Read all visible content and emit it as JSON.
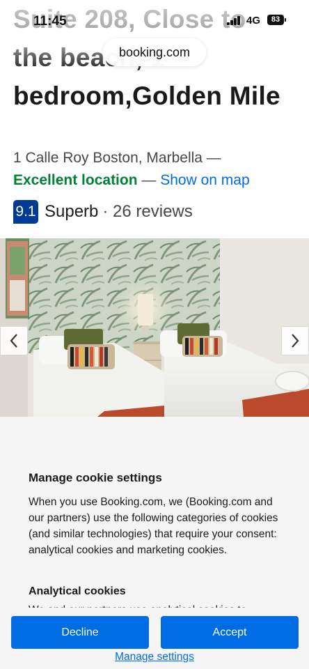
{
  "status_bar": {
    "time": "11:45",
    "network": "4G",
    "battery": "83",
    "url": "booking.com"
  },
  "property": {
    "title": "Suite 208, Close to the beach, 1 bedroom,Golden Mile",
    "address": "1 Calle Roy Boston, Marbella —",
    "location_label": "Excellent location",
    "location_dash": "—",
    "map_link": "Show on map",
    "score": "9.1",
    "score_word": "Superb",
    "reviews": "· 26 reviews"
  },
  "gallery": {
    "prev_icon": "chevron-left-icon",
    "next_icon": "chevron-right-icon"
  },
  "cookie": {
    "title": "Manage cookie settings",
    "body": "When you use Booking.com, we (Booking.com and our partners) use the following categories of cookies (and similar technologies) that require your consent: analytical cookies and marketing cookies.",
    "analytical_title": "Analytical cookies",
    "analytical_text": "We and our partners use analytical cookies to",
    "decline_label": "Decline",
    "accept_label": "Accept",
    "manage_label": "Manage settings"
  },
  "colors": {
    "brand_blue": "#003b95",
    "link_blue": "#006ce4",
    "green": "#008234",
    "sheet_bg": "#f5f5f5"
  }
}
